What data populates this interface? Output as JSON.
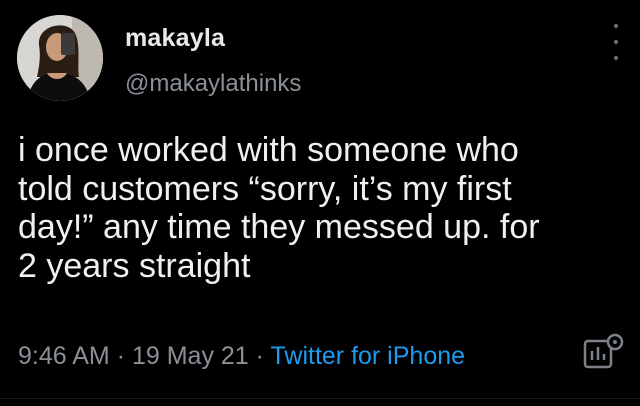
{
  "tweet": {
    "display_name": "makayla",
    "handle": "@makaylathinks",
    "text": "i once worked with someone who\ntold customers “sorry, it’s my first\nday!” any time they messed up. for\n2 years straight",
    "time": "9:46 AM",
    "separator": "·",
    "date": "19 May 21",
    "source": "Twitter for iPhone",
    "icons": [
      "more-options-icon",
      "analytics-icon"
    ]
  },
  "colors": {
    "background": "#000000",
    "text": "#e7e9ea",
    "secondary_text": "#8b9097",
    "link": "#1d9bf0"
  }
}
